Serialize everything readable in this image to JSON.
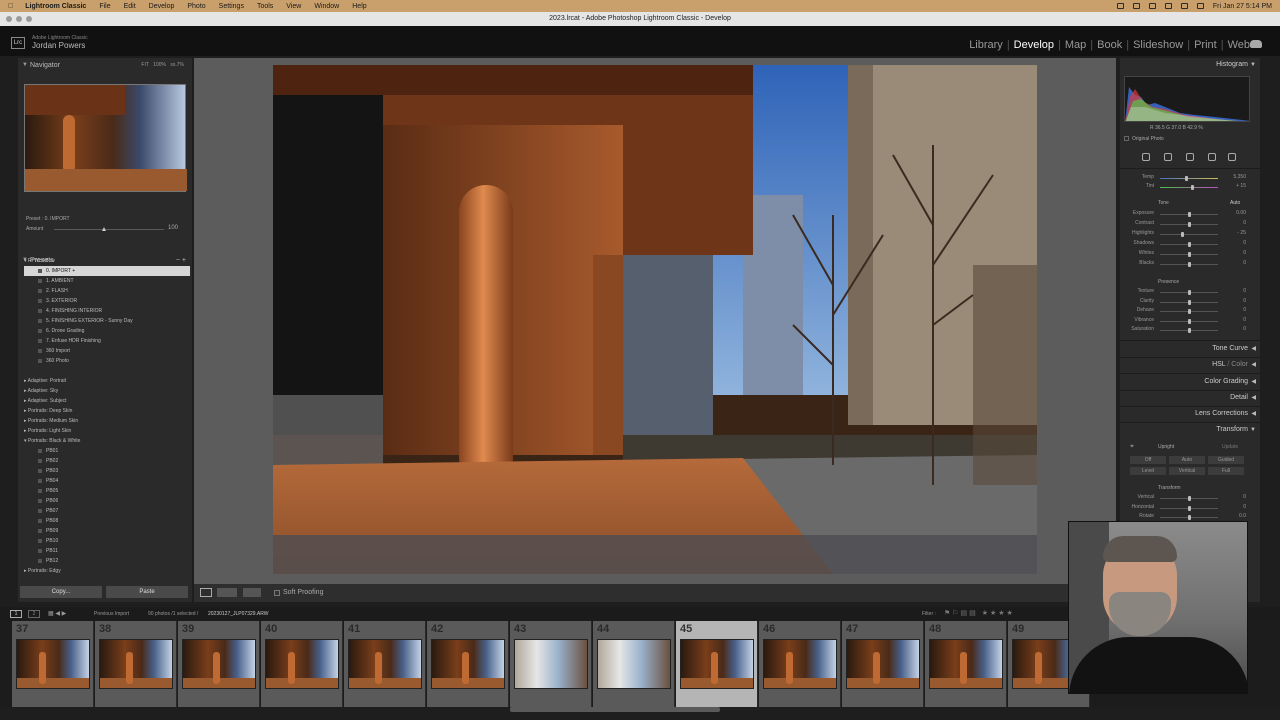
{
  "menubar": {
    "app": "Lightroom Classic",
    "items": [
      "File",
      "Edit",
      "Develop",
      "Photo",
      "Settings",
      "Tools",
      "View",
      "Window",
      "Help"
    ],
    "datetime": "Fri Jan 27  5:14 PM"
  },
  "window": {
    "title": "2023.lrcat - Adobe Photoshop Lightroom Classic - Develop"
  },
  "identity": {
    "logo": "Lrc",
    "subtitle": "Adobe Lightroom Classic",
    "name": "Jordan Powers"
  },
  "modules": [
    "Library",
    "Develop",
    "Map",
    "Book",
    "Slideshow",
    "Print",
    "Web"
  ],
  "navigator": {
    "title": "Navigator",
    "zoom": "FIT  100%  ss.7%"
  },
  "preset_info": {
    "preset_label": "Preset : 0. IMPORT",
    "amount_label": "Amount",
    "amount_value": "100"
  },
  "presets": {
    "title": "Presets",
    "group": "RI Workflow",
    "items": [
      "0. IMPORT +",
      "1. AMBIENT",
      "2. FLASH",
      "3. EXTERIOR",
      "4. FINISHING INTERIOR",
      "5. FINISHING EXTERIOR - Sunny Day",
      "6. Drone Grading",
      "7. Enfuse HDR Finishing",
      "360 Import",
      "360 Photo"
    ],
    "groups2": [
      "Adaptive: Portrait",
      "Adaptive: Sky",
      "Adaptive: Subject",
      "Portraits: Deep Skin",
      "Portraits: Medium Skin",
      "Portraits: Light Skin",
      "Portraits: Black & White"
    ],
    "bw_items": [
      "PB01",
      "PB02",
      "PB03",
      "PB04",
      "PB05",
      "PB06",
      "PB07",
      "PB08",
      "PB09",
      "PB10",
      "PB11",
      "PB12"
    ],
    "tail": [
      "Portraits: Edgy",
      "Portraits: Group"
    ]
  },
  "left_buttons": {
    "copy": "Copy...",
    "paste": "Paste"
  },
  "toolbar": {
    "soft_proofing": "Soft Proofing"
  },
  "histogram": {
    "title": "Histogram",
    "readout": "R  36.5  G  37.0  B  42.9 %",
    "original": "Original Photo"
  },
  "basic": {
    "temp": {
      "label": "Temp",
      "value": "5,350",
      "pos": 0.45
    },
    "tint": {
      "label": "Tint",
      "value": "+ 15",
      "pos": 0.55
    },
    "tone_label": "Tone",
    "auto": "Auto",
    "tone": [
      {
        "label": "Exposure",
        "value": "0.00",
        "pos": 0.5
      },
      {
        "label": "Contrast",
        "value": "0",
        "pos": 0.5
      },
      {
        "label": "Highlights",
        "value": "- 25",
        "pos": 0.38
      },
      {
        "label": "Shadows",
        "value": "0",
        "pos": 0.5
      },
      {
        "label": "Whites",
        "value": "0",
        "pos": 0.5
      },
      {
        "label": "Blacks",
        "value": "0",
        "pos": 0.5
      }
    ],
    "presence_label": "Presence",
    "presence": [
      {
        "label": "Texture",
        "value": "0",
        "pos": 0.5
      },
      {
        "label": "Clarity",
        "value": "0",
        "pos": 0.5
      },
      {
        "label": "Dehaze",
        "value": "0",
        "pos": 0.5
      },
      {
        "label": "Vibrance",
        "value": "0",
        "pos": 0.5
      },
      {
        "label": "Saturation",
        "value": "0",
        "pos": 0.5
      }
    ]
  },
  "right_sections": {
    "tone_curve": "Tone Curve",
    "hsl": "HSL",
    "color": "Color",
    "color_grading": "Color Grading",
    "detail": "Detail",
    "lens": "Lens Corrections",
    "transform": "Transform"
  },
  "transform": {
    "upright": "Upright",
    "update": "Update",
    "buttons": [
      "Off",
      "Auto",
      "Guided",
      "Level",
      "Vertical",
      "Full"
    ],
    "transform_label": "Transform",
    "sliders": [
      {
        "label": "Vertical",
        "value": "0",
        "pos": 0.5
      },
      {
        "label": "Horizontal",
        "value": "0",
        "pos": 0.5
      },
      {
        "label": "Rotate",
        "value": "0.0",
        "pos": 0.5
      }
    ]
  },
  "filmstrip_bar": {
    "page1": "1",
    "page2": "2",
    "source": "Previous Import",
    "count": "90 photos /1 selected /",
    "filename": "20230127_JLP07329.ARW",
    "filter": "Filter :"
  },
  "filmstrip": {
    "selected": "45",
    "numbers": [
      "37",
      "38",
      "39",
      "40",
      "41",
      "42",
      "43",
      "44",
      "45",
      "46",
      "47",
      "48",
      "49"
    ]
  },
  "colors": {
    "menubar": "#c9a06b",
    "selected_preset": "#d6d6d6",
    "center_bg": "#5c5c5c"
  }
}
